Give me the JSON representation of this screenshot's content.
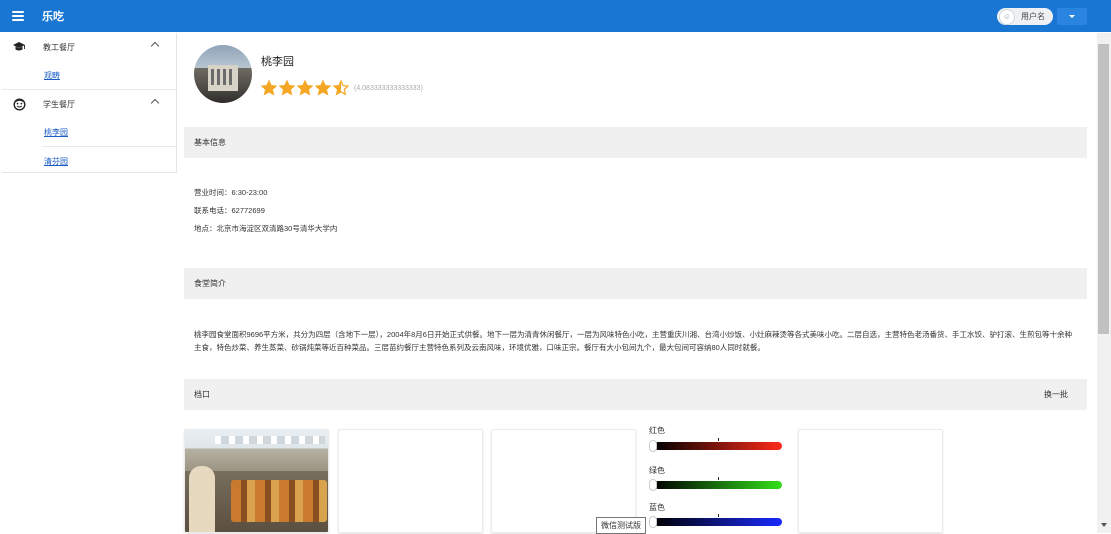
{
  "header": {
    "app_title": "乐吃",
    "user_name": "用户名"
  },
  "sidebar": {
    "groups": [
      {
        "label": "教工餐厅",
        "icon": "graduation-cap-icon",
        "items": [
          {
            "label": "观畴"
          }
        ]
      },
      {
        "label": "学生餐厅",
        "icon": "smiley-face-icon",
        "items": [
          {
            "label": "桃李园"
          },
          {
            "label": "清芬园"
          }
        ]
      }
    ]
  },
  "restaurant": {
    "name": "桃李园",
    "rating_text": "(4.083333333333333)",
    "rating": 4.083333333333333,
    "rating_max": 5,
    "star_color": "#f5a623"
  },
  "basic_info": {
    "section_title": "基本信息",
    "hours": "营业时间：6:30-23:00",
    "phone": "联系电话：62772699",
    "address": "地点：北京市海淀区双清路30号清华大学内"
  },
  "intro": {
    "section_title": "食堂简介",
    "text": "桃李园食堂面积9696平方米，共分为四层（含地下一层），2004年8月6日开始正式供餐。地下一层为清青休闲餐厅，一层为风味特色小吃，主营重庆川湘、台湾小炒饭、小灶麻辣烫等各式美味小吃。二层自选，主营特色老汤番货、手工水饺、驴打滚、生煎包等十余种主食，特色炒菜、养生蒸菜、砂锅炖菜等近百种菜品。三层苗约餐厅主营特色系列及云南风味，环境优雅，口味正宗。餐厅有大小包间九个，最大包间可容纳80人同时就餐。"
  },
  "stalls": {
    "section_title": "档口",
    "refresh_label": "换一批"
  },
  "color_picker": {
    "red_label": "红色",
    "green_label": "绿色",
    "blue_label": "蓝色",
    "red_gradient": [
      "#000000",
      "#ff2a1a"
    ],
    "green_gradient": [
      "#000000",
      "#33e01a"
    ],
    "blue_gradient": [
      "#000000",
      "#1a2aff"
    ]
  },
  "toast": {
    "text": "微信测试版"
  },
  "colors": {
    "primary": "#1976d2",
    "link": "#1a5bc7",
    "section_bg": "#f0f0f0"
  }
}
